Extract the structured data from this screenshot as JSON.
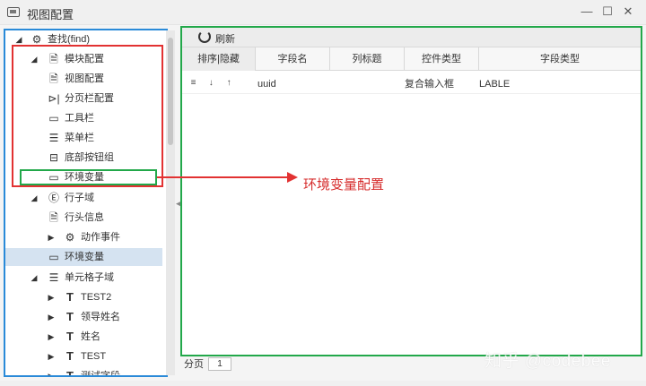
{
  "window": {
    "title": "视图配置",
    "controls": {
      "minimize": "—",
      "maximize": "☐",
      "close": "✕"
    }
  },
  "tree": {
    "items": [
      {
        "label": "查找(find)",
        "icon": "gear-icon",
        "glyph": "⚙",
        "expanded": true
      },
      {
        "label": "模块配置",
        "icon": "document-icon",
        "glyph": "🗎",
        "expanded": true
      },
      {
        "label": "视图配置",
        "icon": "document-icon",
        "glyph": "🗎"
      },
      {
        "label": "分页栏配置",
        "icon": "pager-icon",
        "glyph": "⊳|"
      },
      {
        "label": "工具栏",
        "icon": "toolbar-icon",
        "glyph": "▭"
      },
      {
        "label": "菜单栏",
        "icon": "menu-icon",
        "glyph": "☰"
      },
      {
        "label": "底部按钮组",
        "icon": "button-group-icon",
        "glyph": "⊟"
      },
      {
        "label": "环境变量",
        "icon": "variable-icon",
        "glyph": "▭"
      },
      {
        "label": "行子域",
        "icon": "row-domain-icon",
        "glyph": "Ⓔ",
        "expanded": true
      },
      {
        "label": "行头信息",
        "icon": "document-icon",
        "glyph": "🗎"
      },
      {
        "label": "动作事件",
        "icon": "gear-icon",
        "glyph": "⚙"
      },
      {
        "label": "环境变量",
        "icon": "variable-icon",
        "glyph": "▭"
      },
      {
        "label": "单元格子域",
        "icon": "menu-icon",
        "glyph": "☰",
        "expanded": true
      },
      {
        "label": "TEST2",
        "icon": "text-icon",
        "glyph": "T"
      },
      {
        "label": "领导姓名",
        "icon": "text-icon",
        "glyph": "T"
      },
      {
        "label": "姓名",
        "icon": "text-icon",
        "glyph": "T"
      },
      {
        "label": "TEST",
        "icon": "text-icon",
        "glyph": "T"
      },
      {
        "label": "测试字段",
        "icon": "text-icon",
        "glyph": "T"
      }
    ]
  },
  "annotation": {
    "text": "环境变量配置"
  },
  "grid": {
    "toolbar": {
      "refresh_label": "刷新"
    },
    "columns": [
      "排序|隐藏",
      "字段名",
      "列标题",
      "控件类型",
      "字段类型"
    ],
    "rows": [
      {
        "icons": [
          "≡",
          "↓",
          "↑"
        ],
        "field_name": "uuid",
        "column_title": "",
        "control_type": "复合输入框",
        "field_type": "LABLE"
      }
    ]
  },
  "pager": {
    "label": "分页",
    "page": "1"
  },
  "watermark": "知乎 @codebee",
  "colors": {
    "tree_border": "#2a8ad8",
    "annotation_red": "#e23232",
    "annotation_green": "#22a84a",
    "selected": "#d5e3f1"
  }
}
